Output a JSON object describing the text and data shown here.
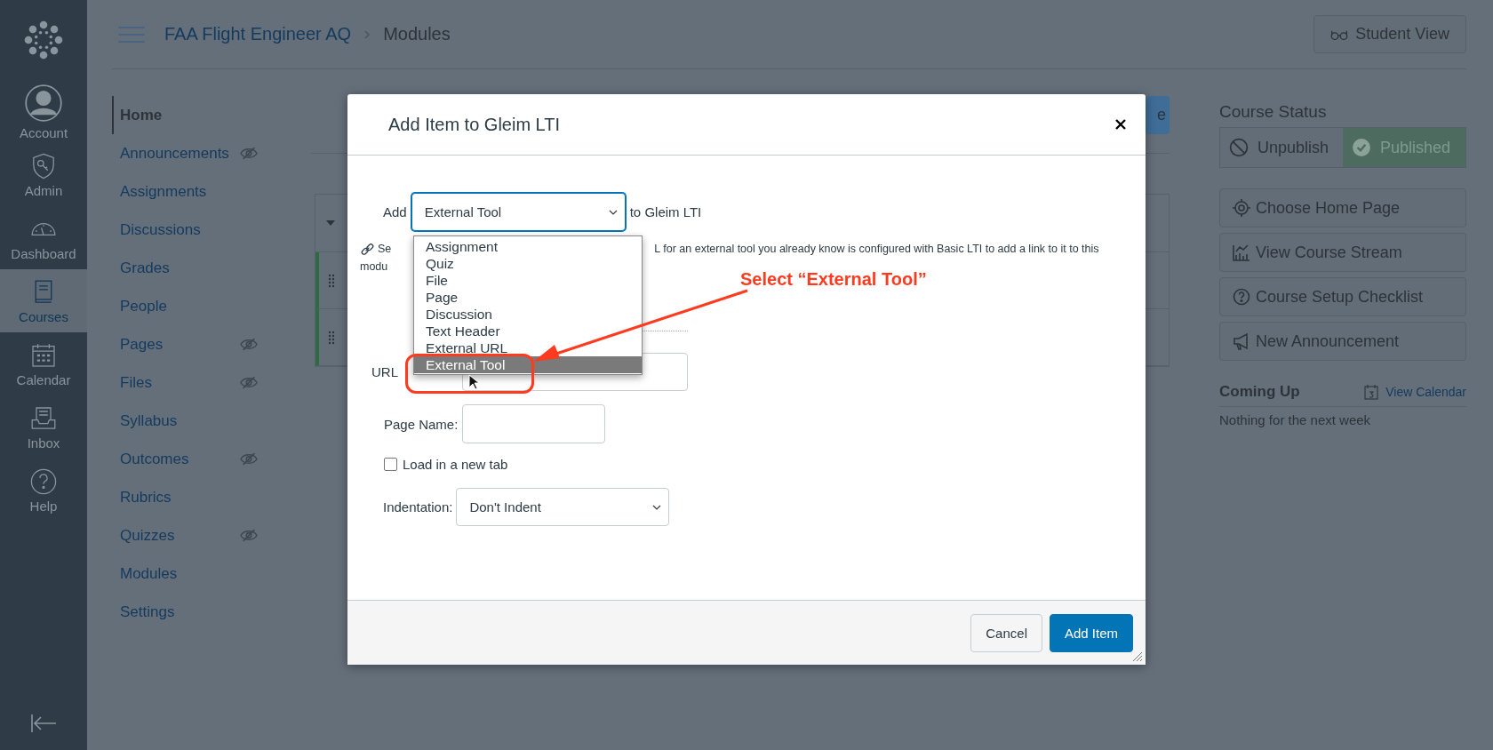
{
  "global_nav": {
    "items": [
      {
        "kind": "account",
        "label": "Account",
        "selected": false
      },
      {
        "kind": "admin",
        "label": "Admin",
        "selected": false
      },
      {
        "kind": "dashboard",
        "label": "Dashboard",
        "selected": false
      },
      {
        "kind": "courses",
        "label": "Courses",
        "selected": true
      },
      {
        "kind": "calendar",
        "label": "Calendar",
        "selected": false
      },
      {
        "kind": "inbox",
        "label": "Inbox",
        "selected": false
      },
      {
        "kind": "help",
        "label": "Help",
        "selected": false
      }
    ]
  },
  "header": {
    "breadcrumbs": [
      "FAA Flight Engineer AQ",
      "Modules"
    ],
    "student_view": "Student View"
  },
  "course_nav": [
    {
      "label": "Home",
      "selected": true,
      "hidden": false
    },
    {
      "label": "Announcements",
      "selected": false,
      "hidden": true
    },
    {
      "label": "Assignments",
      "selected": false,
      "hidden": false
    },
    {
      "label": "Discussions",
      "selected": false,
      "hidden": false
    },
    {
      "label": "Grades",
      "selected": false,
      "hidden": false
    },
    {
      "label": "People",
      "selected": false,
      "hidden": false
    },
    {
      "label": "Pages",
      "selected": false,
      "hidden": true
    },
    {
      "label": "Files",
      "selected": false,
      "hidden": true
    },
    {
      "label": "Syllabus",
      "selected": false,
      "hidden": false
    },
    {
      "label": "Outcomes",
      "selected": false,
      "hidden": true
    },
    {
      "label": "Rubrics",
      "selected": false,
      "hidden": false
    },
    {
      "label": "Quizzes",
      "selected": false,
      "hidden": true
    },
    {
      "label": "Modules",
      "selected": false,
      "hidden": false
    },
    {
      "label": "Settings",
      "selected": false,
      "hidden": false
    }
  ],
  "main": {
    "partial_button": "e"
  },
  "sidebar": {
    "title": "Course Status",
    "status": [
      {
        "kind": "unpublish",
        "label": "Unpublish",
        "selected": false
      },
      {
        "kind": "published",
        "label": "Published",
        "selected": true
      }
    ],
    "actions": [
      {
        "kind": "target",
        "label": "Choose Home Page"
      },
      {
        "kind": "stream",
        "label": "View Course Stream"
      },
      {
        "kind": "question",
        "label": "Course Setup Checklist"
      },
      {
        "kind": "megaphone",
        "label": "New Announcement"
      }
    ],
    "coming_up": {
      "title": "Coming Up",
      "link": "View Calendar",
      "empty": "Nothing for the next week"
    }
  },
  "dialog": {
    "title": "Add Item to Gleim LTI",
    "add_label": "Add",
    "type_select": {
      "value": "External Tool",
      "expanded": true,
      "options": [
        {
          "label": "Assignment",
          "selected": false
        },
        {
          "label": "Quiz",
          "selected": false
        },
        {
          "label": "File",
          "selected": false
        },
        {
          "label": "Page",
          "selected": false
        },
        {
          "label": "Discussion",
          "selected": false
        },
        {
          "label": "Text Header",
          "selected": false
        },
        {
          "label": "External URL",
          "selected": false
        },
        {
          "label": "External Tool",
          "selected": true
        }
      ]
    },
    "target_text": "to Gleim LTI",
    "help_parts": [
      "Se",
      "L for an external tool you already know is configured with Basic LTI to add a link to it to this",
      "modu"
    ],
    "url_label": "URL",
    "page_name_label": "Page Name:",
    "new_tab": {
      "label": "Load in a new tab",
      "checked": false
    },
    "indentation": {
      "label": "Indentation:",
      "value": "Don't Indent"
    },
    "cancel": "Cancel",
    "submit": "Add Item"
  },
  "annotation": {
    "text": "Select “External Tool”"
  }
}
